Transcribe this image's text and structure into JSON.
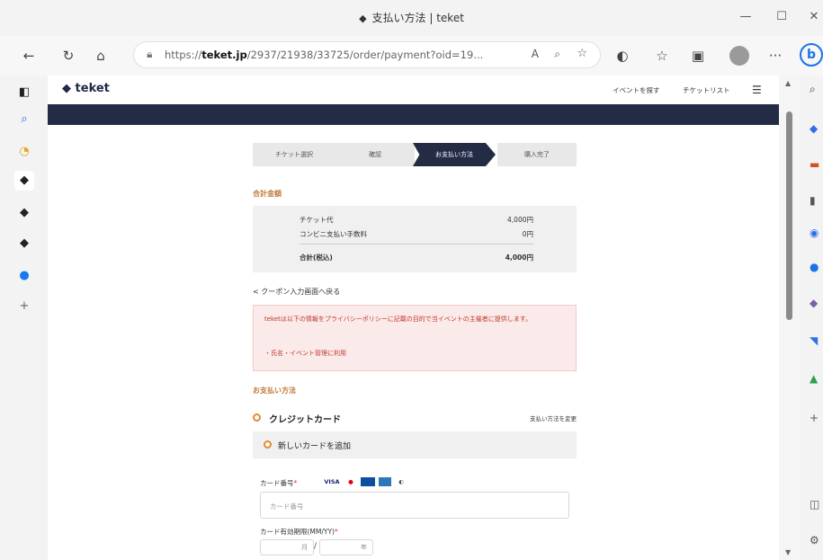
{
  "window": {
    "title": "支払い方法 | teket",
    "minimize": "—",
    "maximize": "☐",
    "close": "✕"
  },
  "browser": {
    "url_prefix": "https://",
    "url_domain": "teket.jp",
    "url_rest": "/2937/21938/33725/order/payment?oid=19...",
    "reader_label": "A",
    "more_label": "···",
    "copilot_label": "b"
  },
  "site": {
    "logo": "teket",
    "nav": [
      "イベントを探す",
      "チケットリスト"
    ]
  },
  "steps": [
    {
      "label": "チケット選択",
      "active": false
    },
    {
      "label": "確認",
      "active": false
    },
    {
      "label": "お支払い方法",
      "active": true
    },
    {
      "label": "購入完了",
      "active": false
    }
  ],
  "total": {
    "heading": "合計金額",
    "rows": [
      {
        "label": "チケット代",
        "amount": "4,000円"
      },
      {
        "label": "コンビニ支払い手数料",
        "amount": "0円"
      }
    ],
    "total_label": "合計(税込)",
    "total_amount": "4,000円"
  },
  "coupon_link": "< クーポン入力画面へ戻る",
  "notice": {
    "line1": "teketは以下の情報をプライバシーポリシーに記載の目的で当イベントの主催者に提供します。",
    "line2": "・氏名・イベント管理に利用"
  },
  "payment": {
    "heading": "お支払い方法",
    "credit_title": "クレジットカード",
    "credit_link": "支払い方法を変更",
    "new_card": "新しいカードを追加",
    "card_number_label": "カード番号",
    "card_number_placeholder": "カード番号",
    "expiry_label": "カード有効期限(MM/YY)",
    "expiry_month": "月",
    "expiry_year": "年",
    "brands": [
      "VISA",
      "MC",
      "JCB",
      "AMEX",
      "DC"
    ]
  }
}
